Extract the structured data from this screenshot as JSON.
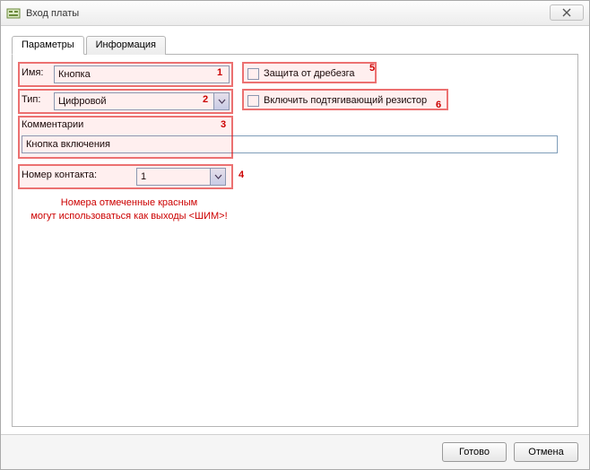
{
  "window": {
    "title": "Вход платы"
  },
  "tabs": {
    "parameters": "Параметры",
    "information": "Информация"
  },
  "form": {
    "name_label": "Имя:",
    "name_value": "Кнопка",
    "type_label": "Тип:",
    "type_value": "Цифровой",
    "comments_label": "Комментарии",
    "comments_value": "Кнопка включения",
    "contact_label": "Номер контакта:",
    "contact_value": "1",
    "debounce_label": "Защита от дребезга",
    "pullup_label": "Включить подтягивающий резистор"
  },
  "annotations": {
    "1": "1",
    "2": "2",
    "3": "3",
    "4": "4",
    "5": "5",
    "6": "6"
  },
  "note": {
    "line1": "Номера отмеченные красным",
    "line2": "могут использоваться как выходы <ШИМ>!"
  },
  "buttons": {
    "ok": "Готово",
    "cancel": "Отмена"
  }
}
